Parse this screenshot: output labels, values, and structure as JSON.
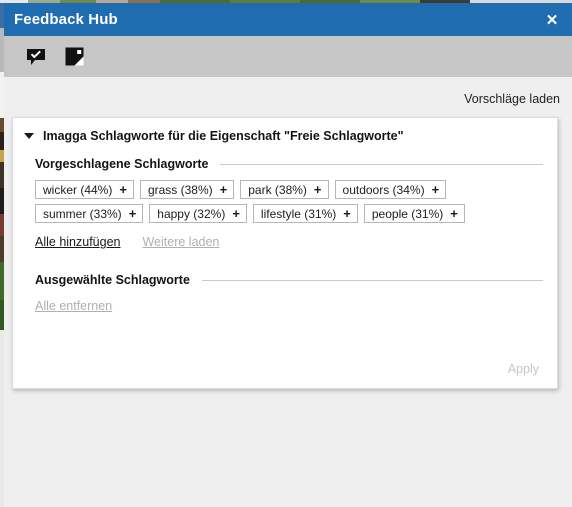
{
  "window": {
    "title": "Feedback Hub",
    "close_label": "✕"
  },
  "tabs": [
    {
      "name": "feedback",
      "icon": "speech-bubble-check-icon",
      "active": false
    },
    {
      "name": "suggestions",
      "icon": "image-tag-icon",
      "active": true
    }
  ],
  "toolbar": {
    "load_suggestions_label": "Vorschläge laden"
  },
  "card": {
    "group_title": "Imagga Schlagworte für die Eigenschaft \"Freie Schlagworte\"",
    "suggested_section_label": "Vorgeschlagene Schlagworte",
    "selected_section_label": "Ausgewählte Schlagworte",
    "add_all_label": "Alle hinzufügen",
    "load_more_label": "Weitere laden",
    "remove_all_label": "Alle entfernen",
    "apply_label": "Apply",
    "suggested_tags": [
      {
        "label": "wicker (44%)",
        "plus": "＋"
      },
      {
        "label": "grass (38%)",
        "plus": "＋"
      },
      {
        "label": "park (38%)",
        "plus": "＋"
      },
      {
        "label": "outdoors (34%)",
        "plus": "＋"
      },
      {
        "label": "summer (33%)",
        "plus": "＋"
      },
      {
        "label": "happy (32%)",
        "plus": "＋"
      },
      {
        "label": "lifestyle (31%)",
        "plus": "＋"
      },
      {
        "label": "people (31%)",
        "plus": "＋"
      }
    ],
    "selected_tags": []
  },
  "colors": {
    "titlebar": "#1f6cb0",
    "tabstrip": "#c6c6c6",
    "page_background": "#efefef",
    "card_background": "#ffffff",
    "disabled_text": "#b0b0b0"
  }
}
